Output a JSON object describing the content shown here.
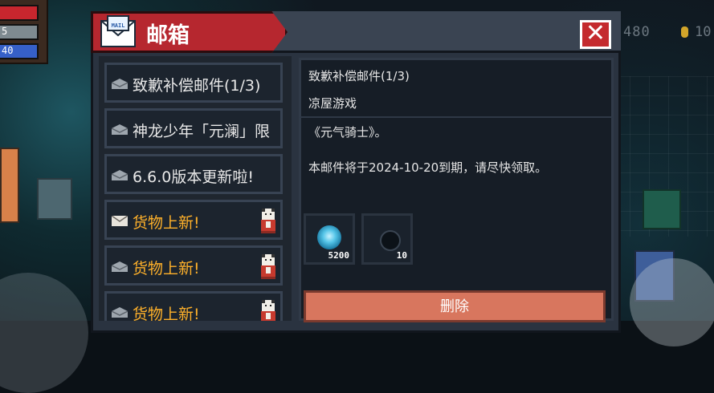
{
  "hud": {
    "bar_shield_text": "5",
    "bar_energy_text": "40",
    "gems_text": "480",
    "coins_text": "10"
  },
  "window": {
    "title": "邮箱",
    "mail_icon_text": "MAIL",
    "close_label": "✕"
  },
  "mail_list": [
    {
      "label": "致歉补偿邮件(1/3)",
      "unread": false,
      "has_reward_cat": false
    },
    {
      "label": "神龙少年「元澜」限",
      "unread": false,
      "has_reward_cat": false
    },
    {
      "label": "6.6.0版本更新啦!",
      "unread": false,
      "has_reward_cat": false
    },
    {
      "label": "货物上新!",
      "unread": true,
      "has_reward_cat": true
    },
    {
      "label": "货物上新!",
      "unread": true,
      "has_reward_cat": true
    },
    {
      "label": "货物上新!",
      "unread": true,
      "has_reward_cat": true
    }
  ],
  "detail": {
    "subject": "致歉补偿邮件(1/3)",
    "sender": "凉屋游戏",
    "body_line1": "《元气骑士》。",
    "body_line2": "本邮件将于2024-10-20到期，请尽快领取。",
    "rewards": [
      {
        "icon": "gem-icon",
        "count": "5200"
      },
      {
        "icon": "feather-icon",
        "count": "10"
      }
    ],
    "delete_label": "删除"
  },
  "colors": {
    "title_red": "#b6272f",
    "unread_orange": "#ffb12a",
    "delete_button": "#d8765e"
  }
}
